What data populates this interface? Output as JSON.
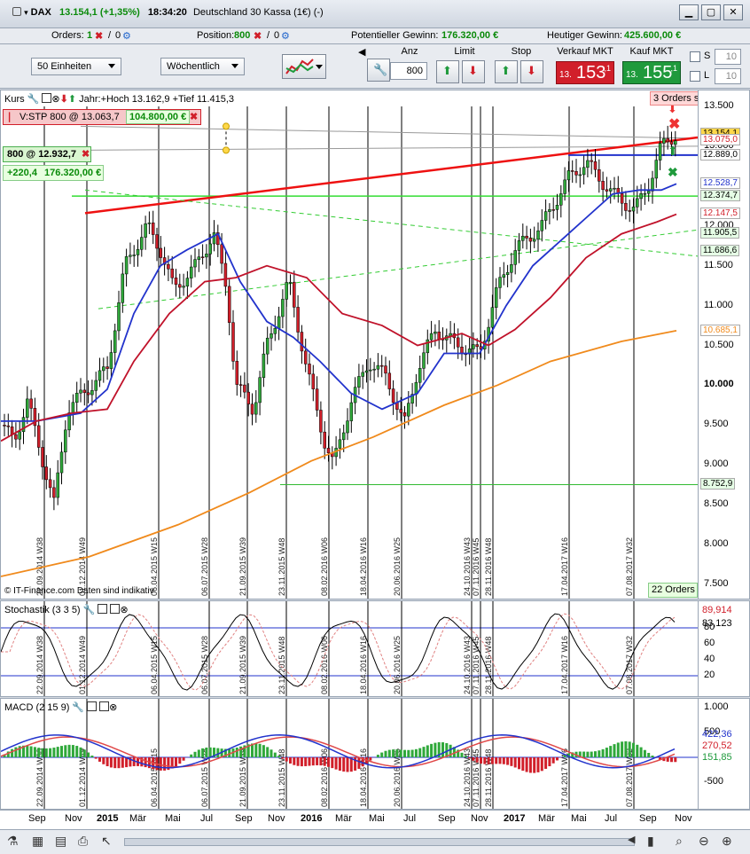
{
  "window": {
    "symbol": "DAX",
    "price_change": "13.154,1 (+1,35%)",
    "time": "18:34:20",
    "instrument": "Deutschland 30 Kassa (1€) (-)"
  },
  "infobar": {
    "orders_label": "Orders:",
    "orders_count": "1",
    "orders_zero": "0",
    "position_label": "Position:",
    "position_value": "800",
    "position_zero": "0",
    "potential_label": "Potentieller Gewinn:",
    "potential_value": "176.320,00 €",
    "today_label": "Heutiger Gewinn:",
    "today_value": "425.600,00 €"
  },
  "toolbar": {
    "units_select": "50 Einheiten",
    "period_select": "Wöchentlich",
    "anz_label": "Anz",
    "anz_value": "800",
    "limit_label": "Limit",
    "stop_label": "Stop",
    "sell_label": "Verkauf MKT",
    "sell_pre": "13.",
    "sell_big": "153",
    "sell_sup": ",1",
    "buy_label": "Kauf MKT",
    "buy_pre": "13.",
    "buy_big": "155",
    "buy_sup": ",1",
    "s_label": "S",
    "s_value": "10",
    "l_label": "L",
    "l_value": "10"
  },
  "main_chart": {
    "header": "Kurs",
    "range_text": "Jahr:+Hoch 13.162,9 +Tief 11.415,3",
    "order_stop": "V:STP 800 @ 13.063,7",
    "order_stop_value": "104.800,00 €",
    "position_tag": "800 @ 12.932,7",
    "position_pts": "+220,4",
    "position_value": "176.320,00 €",
    "orders_top": "3 Orders s",
    "orders_bottom": "22 Orders",
    "copyright": "© IT-Finance.com Daten sind indikativ",
    "y_ticks": [
      "13.500",
      "13.000",
      "12.500",
      "12.000",
      "11.500",
      "11.000",
      "10.500",
      "10.000",
      "9.500",
      "9.000",
      "8.500",
      "8.000",
      "7.500"
    ],
    "price_tags": [
      {
        "text": "13.154,1",
        "bg": "#ffd84a",
        "color": "#000"
      },
      {
        "text": "13.075,0",
        "bg": "#ffffff",
        "color": "#d11f2a"
      },
      {
        "text": "12.889,0",
        "bg": "#ffffff",
        "color": "#000"
      },
      {
        "text": "12.528,7",
        "bg": "#ffffff",
        "color": "#2233cc"
      },
      {
        "text": "12.374,7",
        "bg": "#e6ffe6",
        "color": "#000"
      },
      {
        "text": "12.147,5",
        "bg": "#ffffff",
        "color": "#d11f2a"
      },
      {
        "text": "11.905,5",
        "bg": "#e6ffe6",
        "color": "#000"
      },
      {
        "text": "11.686,6",
        "bg": "#e6ffe6",
        "color": "#000"
      },
      {
        "text": "10.685,1",
        "bg": "#ffffff",
        "color": "#f08a1c"
      },
      {
        "text": "8.752,9",
        "bg": "#e6ffe6",
        "color": "#000"
      }
    ],
    "date_labels": [
      "22.09.2014 W38",
      "01.12.2014 W49",
      "06.04.2015 W15",
      "06.07.2015 W28",
      "21.09.2015 W39",
      "23.11.2015 W48",
      "08.02.2016 W06",
      "18.04.2016 W16",
      "20.06.2016 W25",
      "24.10.2016 W43",
      "07.11.2016 W45",
      "28.11.2016 W48",
      "17.04.2017 W16",
      "07.08.2017 W32"
    ]
  },
  "stochastic": {
    "header": "Stochastik (3 3 5)",
    "y_ticks": [
      "80",
      "60",
      "40",
      "20"
    ],
    "tag_a": "89,914",
    "tag_b": "83,123"
  },
  "macd": {
    "header": "MACD (2 15 9)",
    "y_ticks": [
      "1.000",
      "500",
      "-500"
    ],
    "tag_a": "422,36",
    "tag_b": "270,52",
    "tag_c": "151,85"
  },
  "time_axis": [
    "Sep",
    "Nov",
    "2015",
    "Mär",
    "Mai",
    "Jul",
    "Sep",
    "Nov",
    "2016",
    "Mär",
    "Mai",
    "Jul",
    "Sep",
    "Nov",
    "2017",
    "Mär",
    "Mai",
    "Jul",
    "Sep",
    "Nov"
  ],
  "colors": {
    "accent_green": "#0a8a0a",
    "sell_red": "#d11f2a",
    "buy_green": "#1f9a3c",
    "ma_blue": "#2233cc",
    "ma_red": "#c0122a",
    "ma_orange": "#f08a1c"
  },
  "chart_data": {
    "type": "line",
    "title": "DAX",
    "x": [
      "2014-09",
      "2014-12",
      "2015-04",
      "2015-07",
      "2015-09",
      "2015-11",
      "2016-02",
      "2016-04",
      "2016-06",
      "2016-10",
      "2016-11",
      "2017-04",
      "2017-08",
      "2017-10"
    ],
    "series": [
      {
        "name": "Kurs",
        "values": [
          9500,
          9900,
          12000,
          11300,
          9900,
          11200,
          9000,
          10100,
          9600,
          10700,
          10400,
          12200,
          12100,
          13154
        ]
      }
    ],
    "ylim": [
      7300,
      13700
    ]
  }
}
